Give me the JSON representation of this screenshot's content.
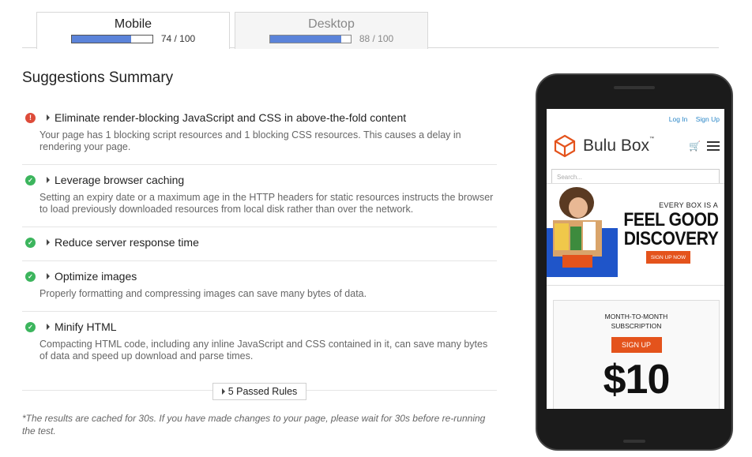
{
  "tabs": [
    {
      "label": "Mobile",
      "score": 74,
      "score_text": "74 / 100",
      "active": true
    },
    {
      "label": "Desktop",
      "score": 88,
      "score_text": "88 / 100",
      "active": false
    }
  ],
  "summary": {
    "title": "Suggestions Summary",
    "rules": [
      {
        "status": "error",
        "icon": "exclamation-icon",
        "title": "Eliminate render-blocking JavaScript and CSS in above-the-fold content",
        "desc": "Your page has 1 blocking script resources and 1 blocking CSS resources. This causes a delay in rendering your page."
      },
      {
        "status": "ok",
        "icon": "check-icon",
        "title": "Leverage browser caching",
        "desc": "Setting an expiry date or a maximum age in the HTTP headers for static resources instructs the browser to load previously downloaded resources from local disk rather than over the network."
      },
      {
        "status": "ok",
        "icon": "check-icon",
        "title": "Reduce server response time",
        "desc": ""
      },
      {
        "status": "ok",
        "icon": "check-icon",
        "title": "Optimize images",
        "desc": "Properly formatting and compressing images can save many bytes of data."
      },
      {
        "status": "ok",
        "icon": "check-icon",
        "title": "Minify HTML",
        "desc": "Compacting HTML code, including any inline JavaScript and CSS contained in it, can save many bytes of data and speed up download and parse times."
      }
    ],
    "passed_label": "5 Passed Rules",
    "footnote": "*The results are cached for 30s. If you have made changes to your page, please wait for 30s before re-running the test."
  },
  "preview": {
    "login": "Log In",
    "signup": "Sign Up",
    "brand": "Bulu Box",
    "trademark": "™",
    "search_placeholder": "Search...",
    "hero_line1": "EVERY BOX IS A",
    "hero_line2": "FEEL GOOD",
    "hero_line3": "DISCOVERY",
    "hero_cta": "SIGN UP NOW",
    "plan_line1": "MONTH-TO-MONTH",
    "plan_line2": "SUBSCRIPTION",
    "plan_cta": "SIGN UP",
    "plan_price": "$10",
    "colors": {
      "accent": "#e4531c",
      "link": "#2a86c7"
    }
  },
  "colors": {
    "bar_fill": "#5b83d9",
    "error": "#dd4b39",
    "ok": "#3cb55d"
  }
}
